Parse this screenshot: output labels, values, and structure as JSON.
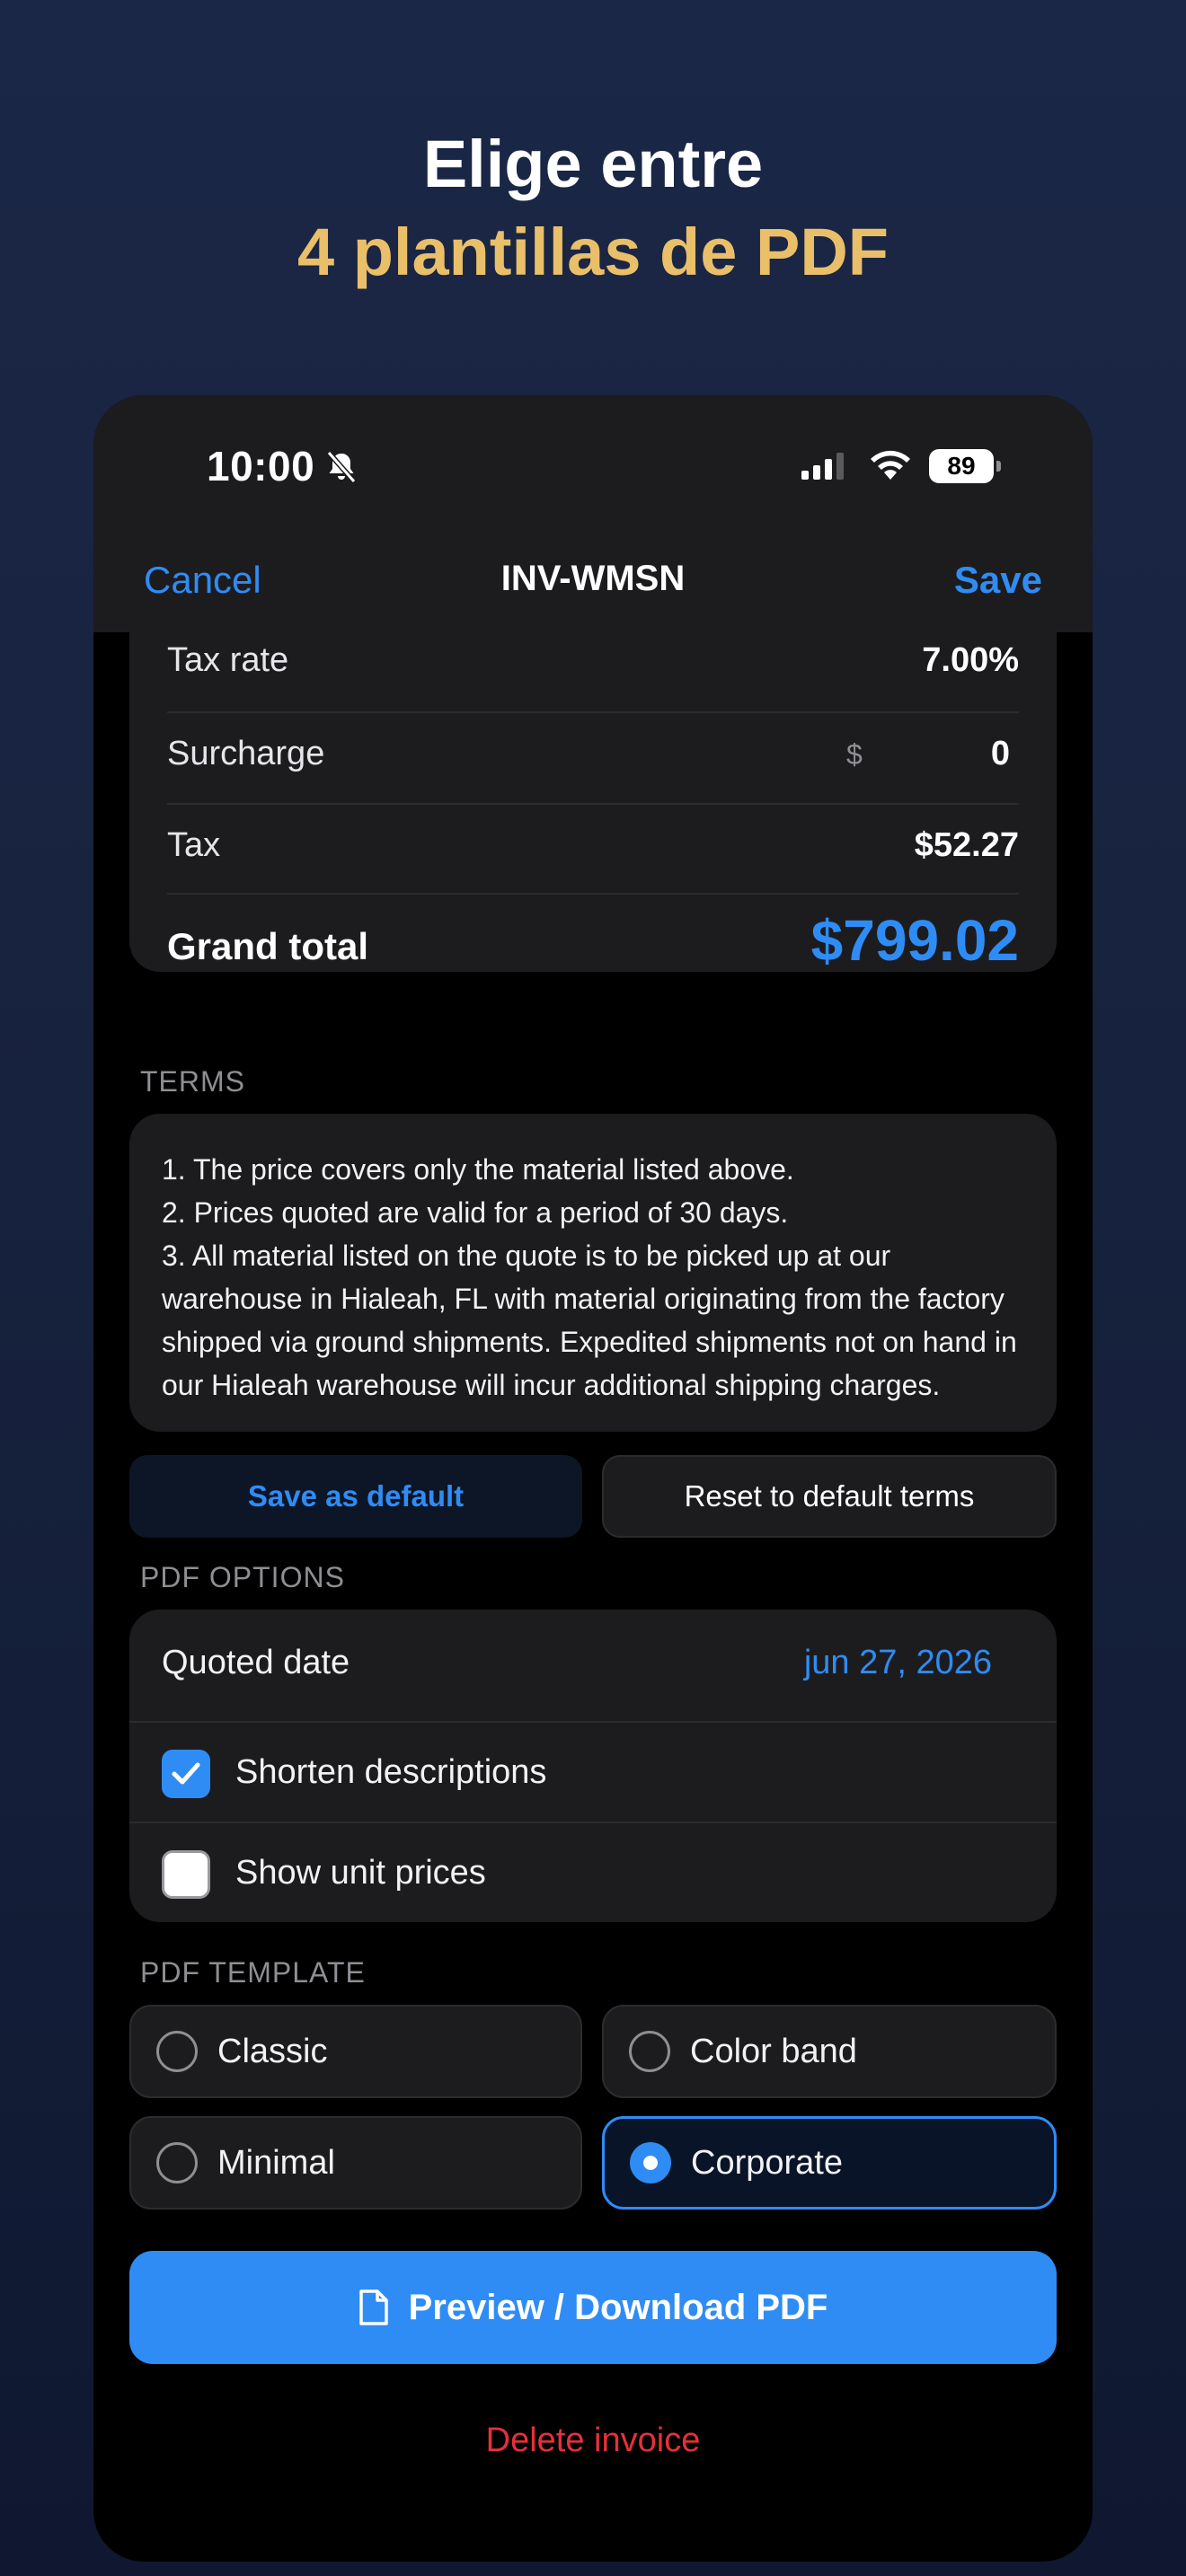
{
  "headline": {
    "line1": "Elige entre",
    "line2": "4 plantillas de PDF"
  },
  "status_bar": {
    "time": "10:00",
    "battery": "89"
  },
  "nav": {
    "cancel": "Cancel",
    "title": "INV-WMSN",
    "save": "Save"
  },
  "totals": {
    "tax_rate_label": "Tax rate",
    "tax_rate_value": "7.00%",
    "surcharge_label": "Surcharge",
    "surcharge_currency": "$",
    "surcharge_value": "0",
    "tax_label": "Tax",
    "tax_value": "$52.27",
    "grand_total_label": "Grand total",
    "grand_total_value": "$799.02"
  },
  "terms": {
    "section_label": "TERMS",
    "lines": [
      "1.  The price covers only the material listed above.",
      "2.  Prices quoted are valid for a period of 30 days.",
      "3.  All material listed on the quote is to be picked up at our warehouse in Hialeah, FL with material originating from the factory shipped via ground shipments. Expedited shipments not on hand in our Hialeah warehouse will incur additional shipping charges."
    ],
    "save_default_label": "Save as default",
    "reset_label": "Reset to default terms"
  },
  "pdf_options": {
    "section_label": "PDF OPTIONS",
    "quoted_date_label": "Quoted date",
    "quoted_date_value": "jun 27, 2026",
    "shorten_label": "Shorten descriptions",
    "shorten_checked": true,
    "unit_prices_label": "Show unit prices",
    "unit_prices_checked": false
  },
  "pdf_template": {
    "section_label": "PDF TEMPLATE",
    "options": [
      "Classic",
      "Color band",
      "Minimal",
      "Corporate"
    ],
    "selected": "Corporate"
  },
  "actions": {
    "preview_label": "Preview / Download PDF",
    "delete_label": "Delete invoice"
  },
  "colors": {
    "accent": "#2f8cf5",
    "gold": "#e9bf6a",
    "danger": "#e5303a",
    "card": "#1c1c1e"
  },
  "icons": [
    "bell-slash-icon",
    "cellular-signal-icon",
    "wifi-icon",
    "battery-icon",
    "checkmark-icon",
    "document-icon"
  ]
}
